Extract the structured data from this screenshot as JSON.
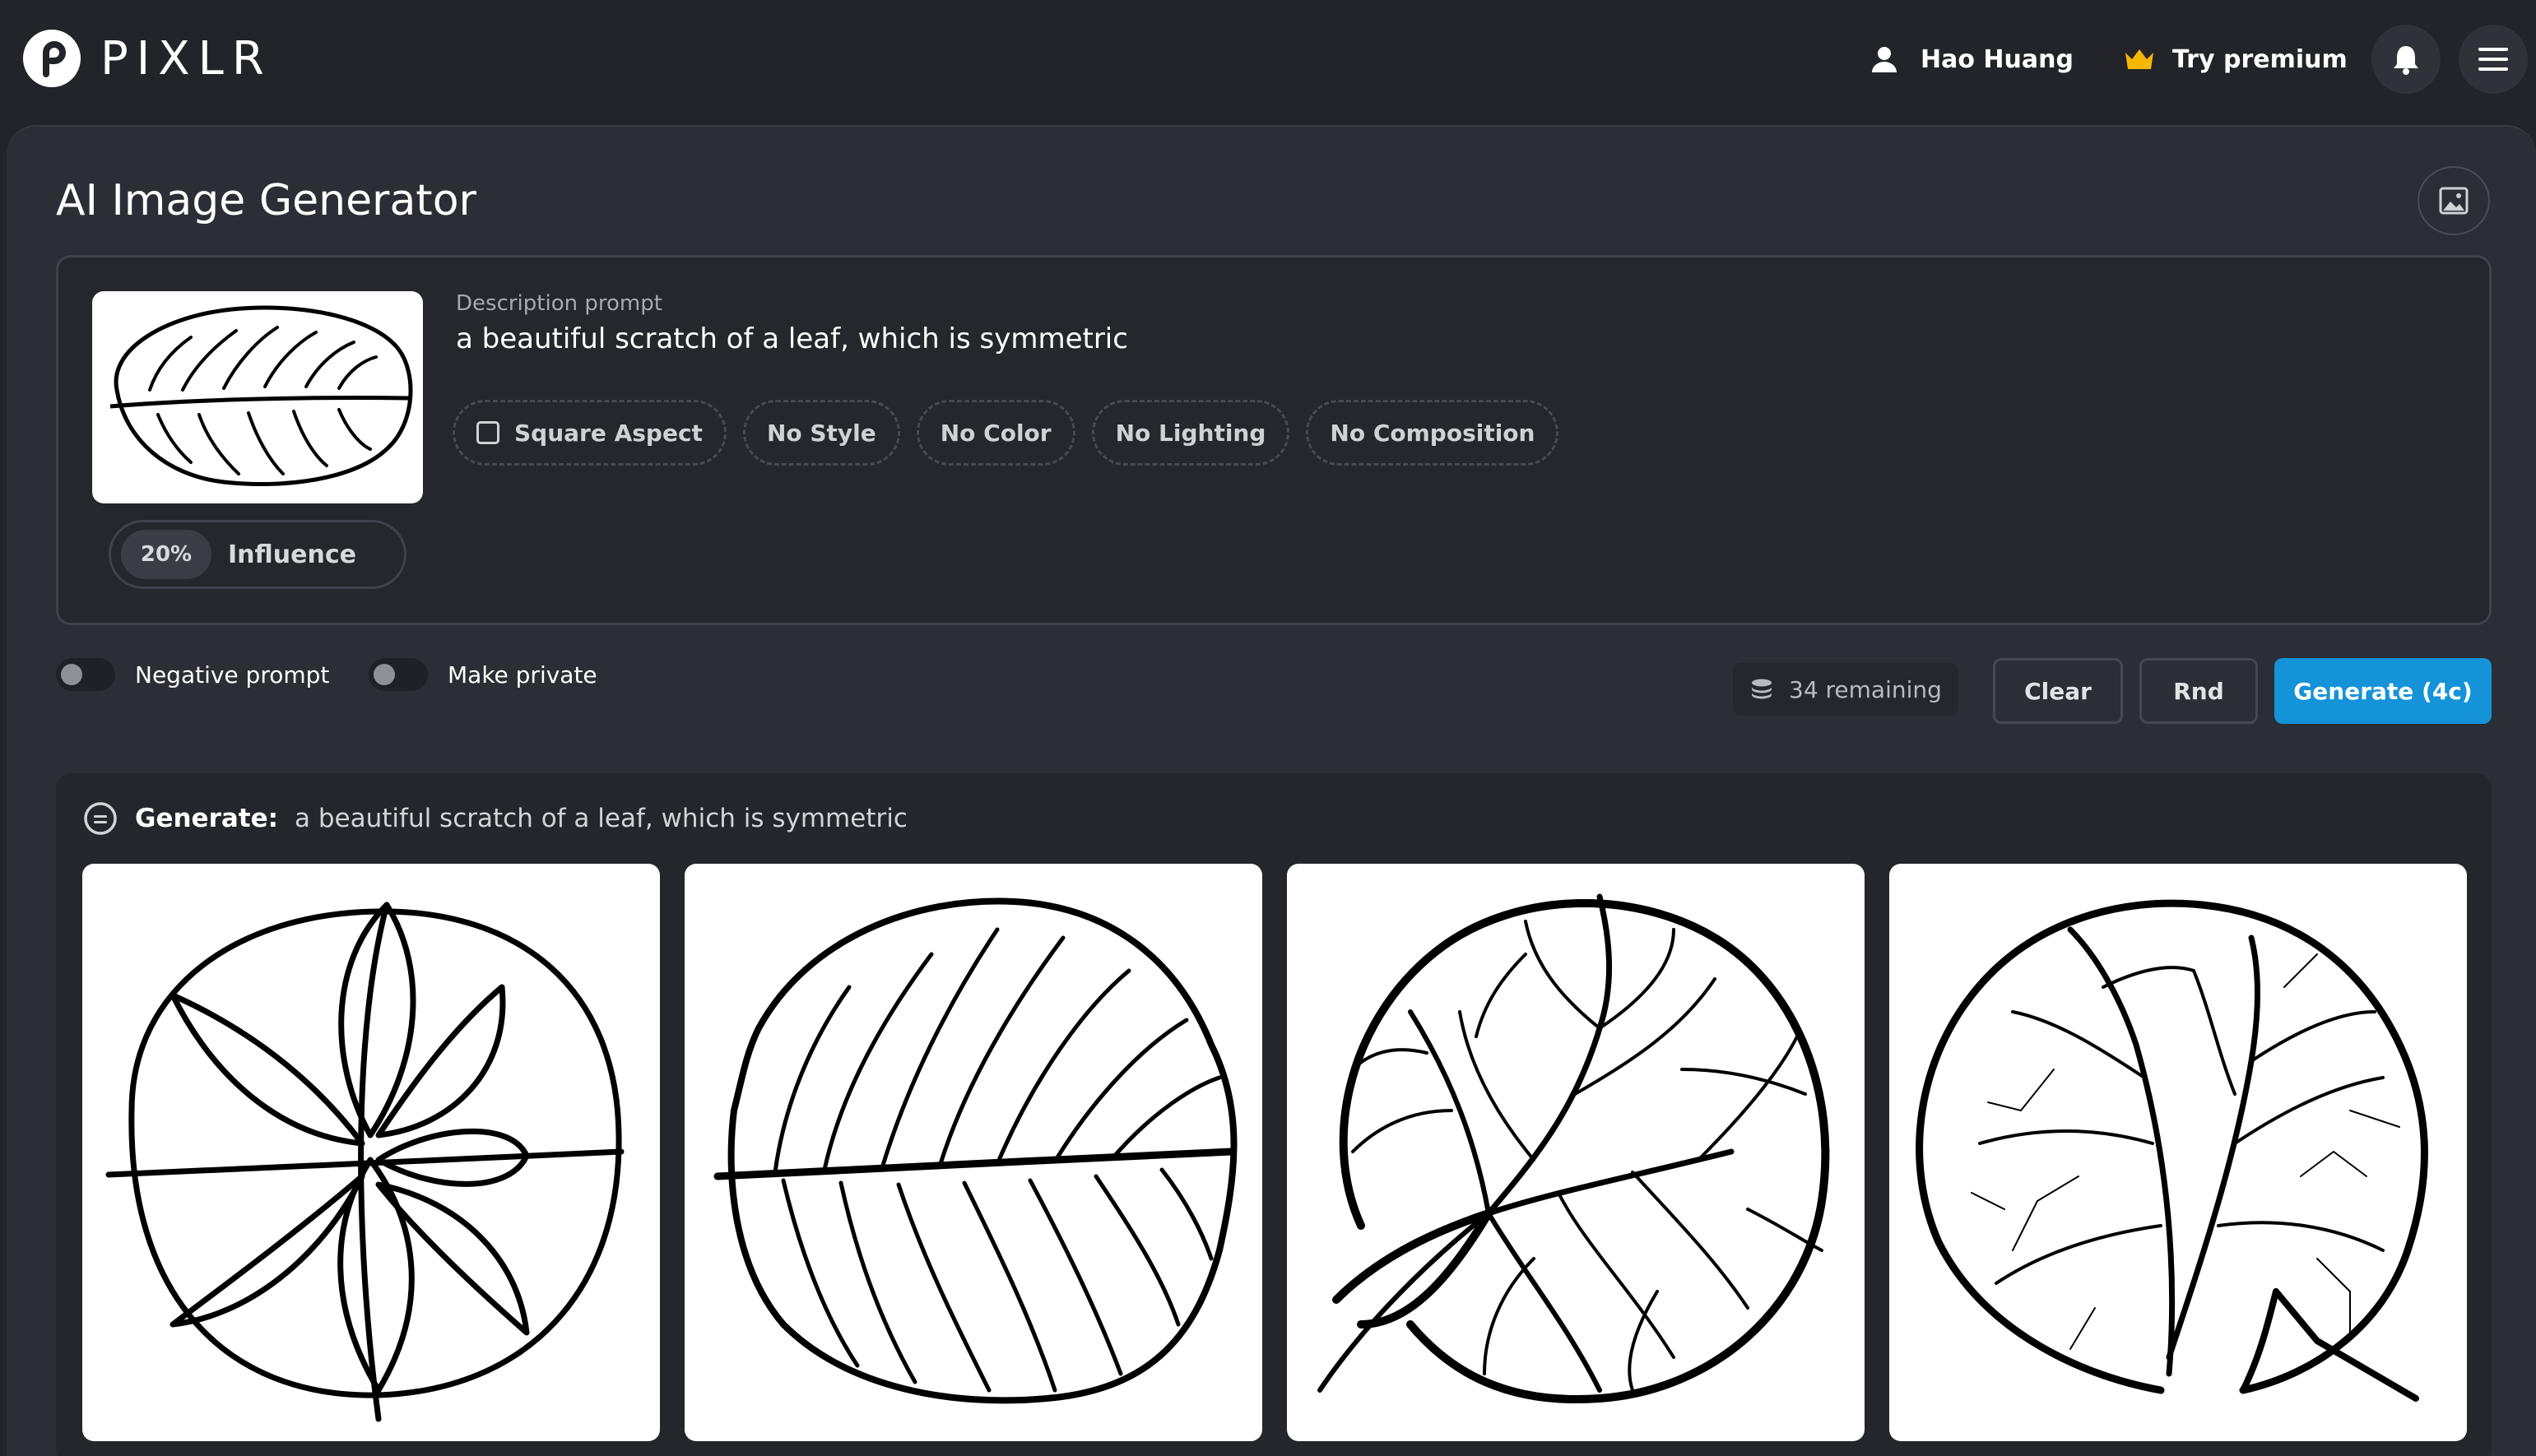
{
  "nav": {
    "brand": "PIXLR",
    "user_name": "Hao Huang",
    "premium_label": "Try premium",
    "accent_premium": "#f5b800"
  },
  "page": {
    "title": "AI Image Generator"
  },
  "prompt": {
    "label": "Description prompt",
    "text": "a beautiful scratch of a leaf, which is symmetric",
    "influence_value": "20%",
    "influence_label": "Influence",
    "chips": [
      "Square Aspect",
      "No Style",
      "No Color",
      "No Lighting",
      "No Composition"
    ]
  },
  "options": {
    "negative_prompt_label": "Negative prompt",
    "make_private_label": "Make private",
    "negative_prompt_enabled": false,
    "make_private_enabled": false
  },
  "actions": {
    "remaining": "34 remaining",
    "clear_label": "Clear",
    "rnd_label": "Rnd",
    "generate_label": "Generate (4c)",
    "generate_color": "#1593d8"
  },
  "results": {
    "header_bold": "Generate:",
    "header_prompt": "a beautiful scratch of a leaf, which is symmetric",
    "images": [
      "leaf-result-1",
      "leaf-result-2",
      "leaf-result-3",
      "leaf-result-4"
    ]
  }
}
